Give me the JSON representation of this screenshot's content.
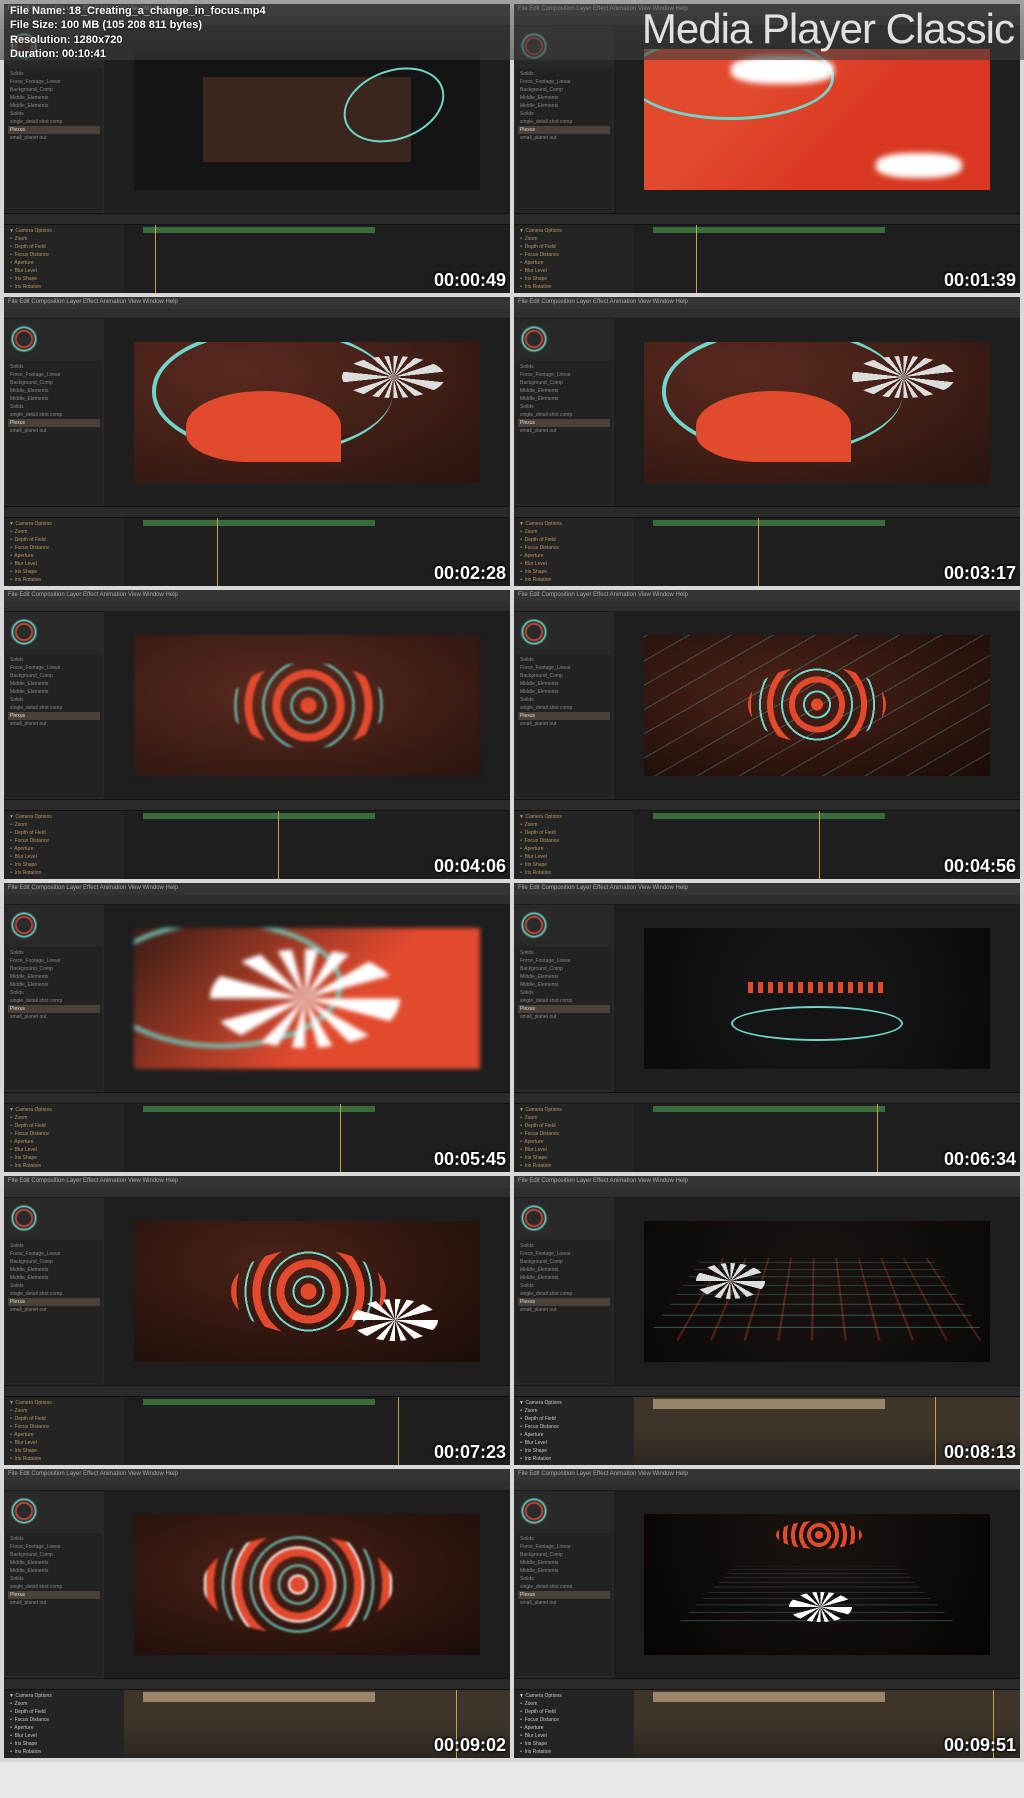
{
  "header": {
    "file_name_label": "File Name:",
    "file_name": "18_Creating_a_change_in_focus.mp4",
    "file_size_label": "File Size:",
    "file_size": "100 MB (105 208 811 bytes)",
    "resolution_label": "Resolution:",
    "resolution": "1280x720",
    "duration_label": "Duration:",
    "duration": "00:10:41",
    "app_title": "Media Player Classic"
  },
  "ae": {
    "menubar": "File  Edit  Composition  Layer  Effect  Animation  View  Window  Help",
    "project_items": [
      "Solids",
      "Force_Footage_Linear",
      "Background_Comp",
      "Middle_Elements",
      "Middle_Elements",
      "Solids",
      "single_detail shot comp",
      "Plexus",
      "small_planet out"
    ],
    "timeline_props": [
      "▼ Camera Options",
      "   ⚬ Zoom",
      "   ⚬ Depth of Field",
      "   ⚬ Focus Distance",
      "   ⚬ Aperture",
      "   ⚬ Blur Level",
      "   ⚬ Iris Shape",
      "   ⚬ Iris Rotation"
    ]
  },
  "thumbs": [
    {
      "ts": "00:00:49",
      "vp": "vp-1",
      "playhead": "8%"
    },
    {
      "ts": "00:01:39",
      "vp": "vp-2",
      "playhead": "16%"
    },
    {
      "ts": "00:02:28",
      "vp": "vp-3",
      "playhead": "24%"
    },
    {
      "ts": "00:03:17",
      "vp": "vp-4",
      "playhead": "32%"
    },
    {
      "ts": "00:04:06",
      "vp": "vp-5",
      "playhead": "40%"
    },
    {
      "ts": "00:04:56",
      "vp": "vp-6",
      "playhead": "48%"
    },
    {
      "ts": "00:05:45",
      "vp": "vp-7",
      "playhead": "56%"
    },
    {
      "ts": "00:06:34",
      "vp": "vp-8",
      "playhead": "63%"
    },
    {
      "ts": "00:07:23",
      "vp": "vp-9",
      "playhead": "71%"
    },
    {
      "ts": "00:08:13",
      "vp": "vp-10",
      "playhead": "78%",
      "alt_timeline": true
    },
    {
      "ts": "00:09:02",
      "vp": "vp-11",
      "playhead": "86%",
      "alt_timeline": true
    },
    {
      "ts": "00:09:51",
      "vp": "vp-12",
      "playhead": "93%",
      "alt_timeline": true
    }
  ]
}
